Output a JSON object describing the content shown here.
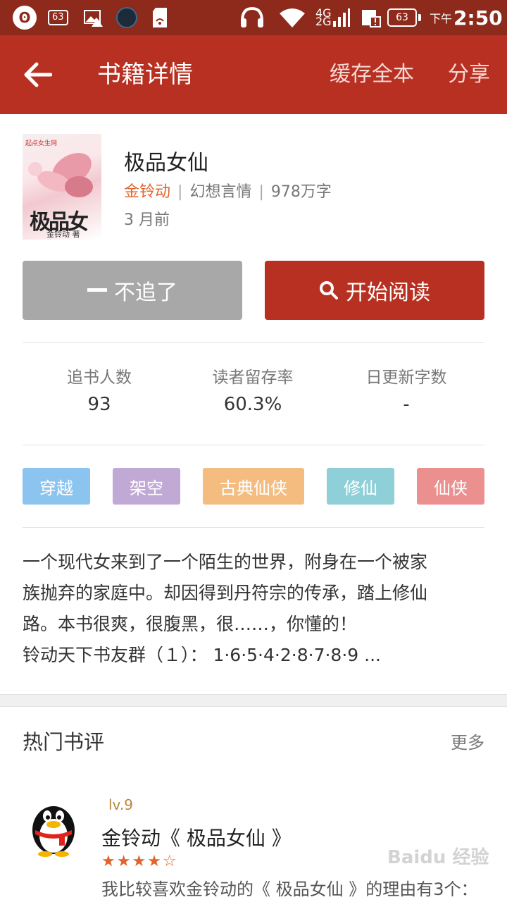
{
  "statusbar": {
    "notif_count": "63",
    "network": "4G",
    "network2": "2G",
    "battery": "63",
    "time_prefix": "下午",
    "time": "2:50"
  },
  "appbar": {
    "title": "书籍详情",
    "cache_label": "缓存全本",
    "share_label": "分享"
  },
  "book": {
    "title": "极品女仙",
    "author": "金铃动",
    "category": "幻想言情",
    "word_count": "978万字",
    "updated": "3 月前",
    "cover_title": "极品女仙",
    "cover_author": "金铃动 著",
    "cover_badge": "起点女生网"
  },
  "actions": {
    "unfollow_label": "不追了",
    "read_label": "开始阅读"
  },
  "stats": [
    {
      "label": "追书人数",
      "value": "93"
    },
    {
      "label": "读者留存率",
      "value": "60.3%"
    },
    {
      "label": "日更新字数",
      "value": "-"
    }
  ],
  "tags": [
    {
      "label": "穿越",
      "color": "#8cc4f0"
    },
    {
      "label": "架空",
      "color": "#c1a9d6"
    },
    {
      "label": "古典仙侠",
      "color": "#f5bc80"
    },
    {
      "label": "修仙",
      "color": "#8ecfd8"
    },
    {
      "label": "仙侠",
      "color": "#ec8f8f"
    }
  ],
  "description": [
    "一个现代女来到了一个陌生的世界，附身在一个被家",
    "族抛弃的家庭中。却因得到丹符宗的传承，踏上修仙",
    "路。本书很爽，很腹黑，很……，你懂的！",
    "铃动天下书友群（１）： 1·6·5·4·2·8·7·8·9 ..."
  ],
  "reviews_section": {
    "title": "热门书评",
    "more_label": "更多"
  },
  "review": {
    "level": "lv.9",
    "title": "金铃动《 极品女仙 》",
    "rating": 4,
    "rating_max": 5,
    "stars_text": "★★★★☆",
    "excerpt": "我比较喜欢金铃动的《 极品女仙 》的理由有3个："
  },
  "watermark": "Baidu 经验",
  "colors": {
    "status_bar": "#8e2a1c",
    "app_bar": "#b83022",
    "accent": "#e2642a",
    "unfollow_bg": "#a8a8a8",
    "read_bg": "#b83022"
  }
}
